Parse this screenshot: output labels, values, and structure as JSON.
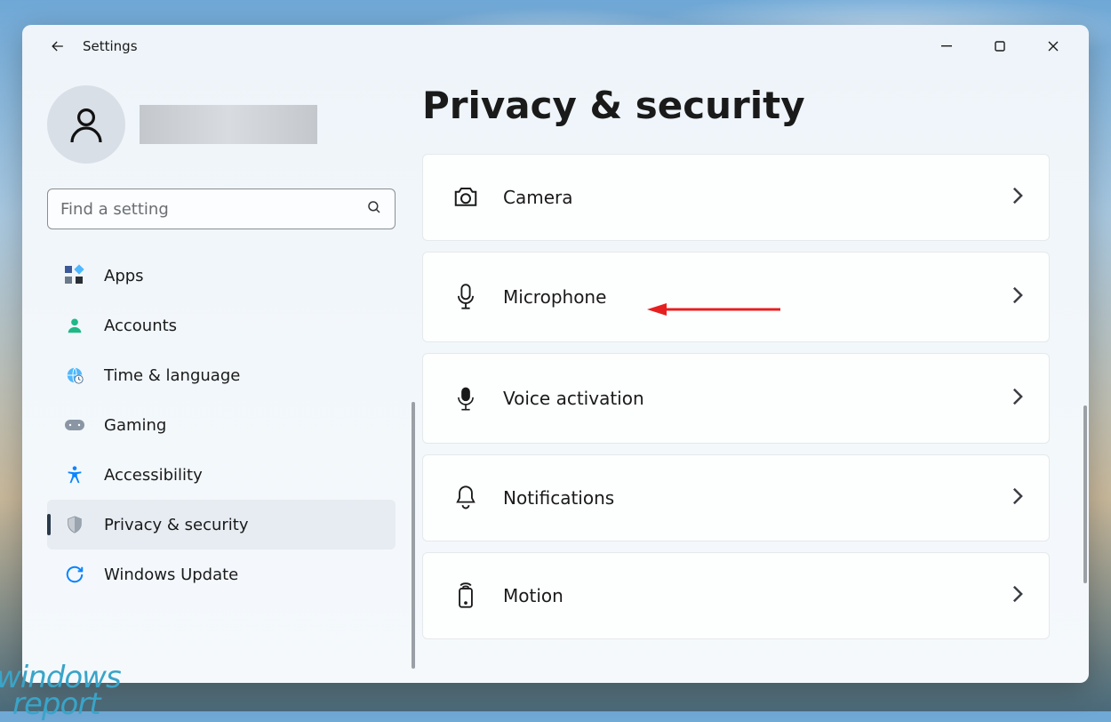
{
  "app": {
    "title": "Settings"
  },
  "search": {
    "placeholder": "Find a setting"
  },
  "sidebar": {
    "items": [
      {
        "label": "Apps"
      },
      {
        "label": "Accounts"
      },
      {
        "label": "Time & language"
      },
      {
        "label": "Gaming"
      },
      {
        "label": "Accessibility"
      },
      {
        "label": "Privacy & security"
      },
      {
        "label": "Windows Update"
      }
    ]
  },
  "page": {
    "title": "Privacy & security"
  },
  "settings": [
    {
      "label": "Camera"
    },
    {
      "label": "Microphone"
    },
    {
      "label": "Voice activation"
    },
    {
      "label": "Notifications"
    },
    {
      "label": "Motion"
    }
  ],
  "watermark": {
    "line1": "windows",
    "line2": "report"
  }
}
